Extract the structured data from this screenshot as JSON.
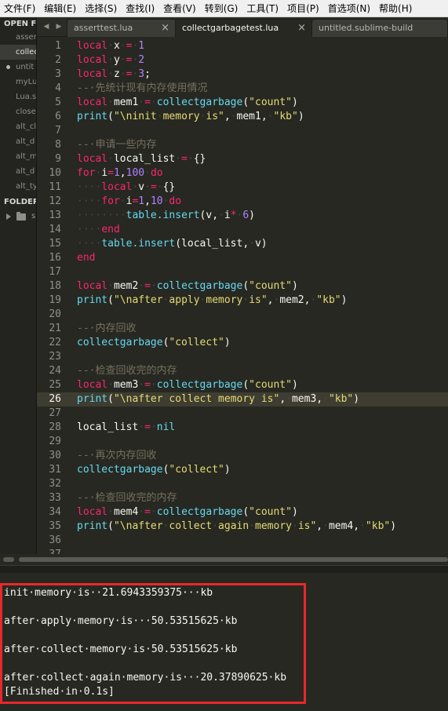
{
  "menu": [
    "文件(F)",
    "编辑(E)",
    "选择(S)",
    "查找(I)",
    "查看(V)",
    "转到(G)",
    "工具(T)",
    "项目(P)",
    "首选项(N)",
    "帮助(H)"
  ],
  "sidebar": {
    "open_files_header": "OPEN FI",
    "files": [
      "asser",
      "collec",
      "untit",
      "myLu",
      "Lua.s",
      "close",
      "alt_cl",
      "alt_d",
      "alt_m",
      "alt_d",
      "alt_ty"
    ],
    "folders_header": "FOLDER",
    "folder_name": "s"
  },
  "tabs": [
    {
      "label": "asserttest.lua",
      "close": "×"
    },
    {
      "label": "collectgarbagetest.lua",
      "close": "×"
    },
    {
      "label": "untitled.sublime-build",
      "close": ""
    }
  ],
  "tab_nav": {
    "left": "◀",
    "right": "▶"
  },
  "colors": {
    "keyword": "#f92672",
    "function": "#66d9ef",
    "string": "#e6db74",
    "number": "#ae81ff",
    "comment": "#75715e",
    "highlight_box": "#e8282b"
  },
  "editor": {
    "current_line": 26,
    "lines": [
      {
        "n": "1",
        "t": [
          [
            "kw",
            "local"
          ],
          [
            "ws",
            "·"
          ],
          [
            "",
            "x"
          ],
          [
            "ws",
            "·"
          ],
          [
            "kw",
            "="
          ],
          [
            "ws",
            "·"
          ],
          [
            "num",
            "1"
          ]
        ]
      },
      {
        "n": "2",
        "t": [
          [
            "kw",
            "local"
          ],
          [
            "ws",
            "·"
          ],
          [
            "",
            "y"
          ],
          [
            "ws",
            "·"
          ],
          [
            "kw",
            "="
          ],
          [
            "ws",
            "·"
          ],
          [
            "num",
            "2"
          ]
        ]
      },
      {
        "n": "3",
        "t": [
          [
            "kw",
            "local"
          ],
          [
            "ws",
            "·"
          ],
          [
            "",
            "z"
          ],
          [
            "ws",
            "·"
          ],
          [
            "kw",
            "="
          ],
          [
            "ws",
            "·"
          ],
          [
            "num",
            "3"
          ],
          [
            "",
            ";"
          ]
        ]
      },
      {
        "n": "4",
        "t": [
          [
            "cmt",
            "--·先统计现有内存使用情况"
          ]
        ]
      },
      {
        "n": "5",
        "t": [
          [
            "kw",
            "local"
          ],
          [
            "ws",
            "·"
          ],
          [
            "",
            "mem1"
          ],
          [
            "ws",
            "·"
          ],
          [
            "kw",
            "="
          ],
          [
            "ws",
            "·"
          ],
          [
            "fn",
            "collectgarbage"
          ],
          [
            "",
            "("
          ],
          [
            "str",
            "\"count\""
          ],
          [
            "",
            ")"
          ]
        ]
      },
      {
        "n": "6",
        "t": [
          [
            "fn",
            "print"
          ],
          [
            "",
            "("
          ],
          [
            "str",
            "\"\\ninit"
          ],
          [
            "ws",
            "·"
          ],
          [
            "str",
            "memory"
          ],
          [
            "ws",
            "·"
          ],
          [
            "str",
            "is\""
          ],
          [
            "",
            ","
          ],
          [
            "ws",
            "·"
          ],
          [
            "",
            "mem1,"
          ],
          [
            "ws",
            "·"
          ],
          [
            "str",
            "\"kb\""
          ],
          [
            "",
            ")"
          ]
        ]
      },
      {
        "n": "7",
        "t": []
      },
      {
        "n": "8",
        "t": [
          [
            "cmt",
            "--·申请一些内存"
          ]
        ]
      },
      {
        "n": "9",
        "t": [
          [
            "kw",
            "local"
          ],
          [
            "ws",
            "·"
          ],
          [
            "",
            "local_list"
          ],
          [
            "ws",
            "·"
          ],
          [
            "kw",
            "="
          ],
          [
            "ws",
            "·"
          ],
          [
            "",
            "{}"
          ]
        ]
      },
      {
        "n": "10",
        "t": [
          [
            "kw",
            "for"
          ],
          [
            "ws",
            "·"
          ],
          [
            "",
            "i"
          ],
          [
            "kw",
            "="
          ],
          [
            "num",
            "1"
          ],
          [
            "",
            ","
          ],
          [
            "num",
            "100"
          ],
          [
            "ws",
            "·"
          ],
          [
            "kw",
            "do"
          ]
        ]
      },
      {
        "n": "11",
        "t": [
          [
            "ws",
            "····"
          ],
          [
            "kw",
            "local"
          ],
          [
            "ws",
            "·"
          ],
          [
            "",
            "v"
          ],
          [
            "ws",
            "·"
          ],
          [
            "kw",
            "="
          ],
          [
            "ws",
            "·"
          ],
          [
            "",
            "{}"
          ]
        ]
      },
      {
        "n": "12",
        "t": [
          [
            "ws",
            "····"
          ],
          [
            "kw",
            "for"
          ],
          [
            "ws",
            "·"
          ],
          [
            "",
            "i"
          ],
          [
            "kw",
            "="
          ],
          [
            "num",
            "1"
          ],
          [
            "",
            ","
          ],
          [
            "num",
            "10"
          ],
          [
            "ws",
            "·"
          ],
          [
            "kw",
            "do"
          ]
        ]
      },
      {
        "n": "13",
        "t": [
          [
            "ws",
            "········"
          ],
          [
            "fn",
            "table.insert"
          ],
          [
            "",
            "(v,"
          ],
          [
            "ws",
            "·"
          ],
          [
            "",
            "i"
          ],
          [
            "kw",
            "*"
          ],
          [
            "ws",
            "·"
          ],
          [
            "num",
            "6"
          ],
          [
            "",
            ")"
          ]
        ]
      },
      {
        "n": "14",
        "t": [
          [
            "ws",
            "····"
          ],
          [
            "kw",
            "end"
          ]
        ]
      },
      {
        "n": "15",
        "t": [
          [
            "ws",
            "····"
          ],
          [
            "fn",
            "table.insert"
          ],
          [
            "",
            "(local_list,"
          ],
          [
            "ws",
            "·"
          ],
          [
            "",
            "v)"
          ]
        ]
      },
      {
        "n": "16",
        "t": [
          [
            "kw",
            "end"
          ]
        ]
      },
      {
        "n": "17",
        "t": []
      },
      {
        "n": "18",
        "t": [
          [
            "kw",
            "local"
          ],
          [
            "ws",
            "·"
          ],
          [
            "",
            "mem2"
          ],
          [
            "ws",
            "·"
          ],
          [
            "kw",
            "="
          ],
          [
            "ws",
            "·"
          ],
          [
            "fn",
            "collectgarbage"
          ],
          [
            "",
            "("
          ],
          [
            "str",
            "\"count\""
          ],
          [
            "",
            ")"
          ]
        ]
      },
      {
        "n": "19",
        "t": [
          [
            "fn",
            "print"
          ],
          [
            "",
            "("
          ],
          [
            "str",
            "\"\\nafter"
          ],
          [
            "ws",
            "·"
          ],
          [
            "str",
            "apply"
          ],
          [
            "ws",
            "·"
          ],
          [
            "str",
            "memory"
          ],
          [
            "ws",
            "·"
          ],
          [
            "str",
            "is\""
          ],
          [
            "",
            ","
          ],
          [
            "ws",
            "·"
          ],
          [
            "",
            "mem2,"
          ],
          [
            "ws",
            "·"
          ],
          [
            "str",
            "\"kb\""
          ],
          [
            "",
            ")"
          ]
        ]
      },
      {
        "n": "20",
        "t": []
      },
      {
        "n": "21",
        "t": [
          [
            "cmt",
            "--·内存回收"
          ]
        ]
      },
      {
        "n": "22",
        "t": [
          [
            "fn",
            "collectgarbage"
          ],
          [
            "",
            "("
          ],
          [
            "str",
            "\"collect\""
          ],
          [
            "",
            ")"
          ]
        ]
      },
      {
        "n": "23",
        "t": []
      },
      {
        "n": "24",
        "t": [
          [
            "cmt",
            "--·检查回收完的内存"
          ]
        ]
      },
      {
        "n": "25",
        "t": [
          [
            "kw",
            "local"
          ],
          [
            "ws",
            "·"
          ],
          [
            "",
            "mem3"
          ],
          [
            "ws",
            "·"
          ],
          [
            "kw",
            "="
          ],
          [
            "ws",
            "·"
          ],
          [
            "fn",
            "collectgarbage"
          ],
          [
            "",
            "("
          ],
          [
            "str",
            "\"count\""
          ],
          [
            "",
            ")"
          ]
        ]
      },
      {
        "n": "26",
        "t": [
          [
            "fn",
            "print"
          ],
          [
            "",
            "("
          ],
          [
            "str",
            "\"\\nafter"
          ],
          [
            "ws",
            "·"
          ],
          [
            "str",
            "collect"
          ],
          [
            "ws",
            "·"
          ],
          [
            "str",
            "memory"
          ],
          [
            "ws",
            "·"
          ],
          [
            "str",
            "is\""
          ],
          [
            "",
            ","
          ],
          [
            "ws",
            "·"
          ],
          [
            "",
            "mem3,"
          ],
          [
            "ws",
            "·"
          ],
          [
            "str",
            "\"kb\""
          ],
          [
            "",
            ")"
          ]
        ]
      },
      {
        "n": "27",
        "t": []
      },
      {
        "n": "28",
        "t": [
          [
            "",
            "local_list"
          ],
          [
            "ws",
            "·"
          ],
          [
            "kw",
            "="
          ],
          [
            "ws",
            "·"
          ],
          [
            "fn",
            "nil"
          ]
        ]
      },
      {
        "n": "29",
        "t": []
      },
      {
        "n": "30",
        "t": [
          [
            "cmt",
            "--·再次内存回收"
          ]
        ]
      },
      {
        "n": "31",
        "t": [
          [
            "fn",
            "collectgarbage"
          ],
          [
            "",
            "("
          ],
          [
            "str",
            "\"collect\""
          ],
          [
            "",
            ")"
          ]
        ]
      },
      {
        "n": "32",
        "t": []
      },
      {
        "n": "33",
        "t": [
          [
            "cmt",
            "--·检查回收完的内存"
          ]
        ]
      },
      {
        "n": "34",
        "t": [
          [
            "kw",
            "local"
          ],
          [
            "ws",
            "·"
          ],
          [
            "",
            "mem4"
          ],
          [
            "ws",
            "·"
          ],
          [
            "kw",
            "="
          ],
          [
            "ws",
            "·"
          ],
          [
            "fn",
            "collectgarbage"
          ],
          [
            "",
            "("
          ],
          [
            "str",
            "\"count\""
          ],
          [
            "",
            ")"
          ]
        ]
      },
      {
        "n": "35",
        "t": [
          [
            "fn",
            "print"
          ],
          [
            "",
            "("
          ],
          [
            "str",
            "\"\\nafter"
          ],
          [
            "ws",
            "·"
          ],
          [
            "str",
            "collect"
          ],
          [
            "ws",
            "·"
          ],
          [
            "str",
            "again"
          ],
          [
            "ws",
            "·"
          ],
          [
            "str",
            "memory"
          ],
          [
            "ws",
            "·"
          ],
          [
            "str",
            "is\""
          ],
          [
            "",
            ","
          ],
          [
            "ws",
            "·"
          ],
          [
            "",
            "mem4,"
          ],
          [
            "ws",
            "·"
          ],
          [
            "str",
            "\"kb\""
          ],
          [
            "",
            ")"
          ]
        ]
      },
      {
        "n": "36",
        "t": []
      },
      {
        "n": "37",
        "t": []
      }
    ]
  },
  "output": {
    "lines": [
      "init·memory·is··21.6943359375···kb",
      "",
      "after·apply·memory·is···50.53515625·kb",
      "",
      "after·collect·memory·is·50.53515625·kb",
      "",
      "after·collect·again·memory·is···20.37890625·kb",
      "[Finished·in·0.1s]"
    ]
  }
}
